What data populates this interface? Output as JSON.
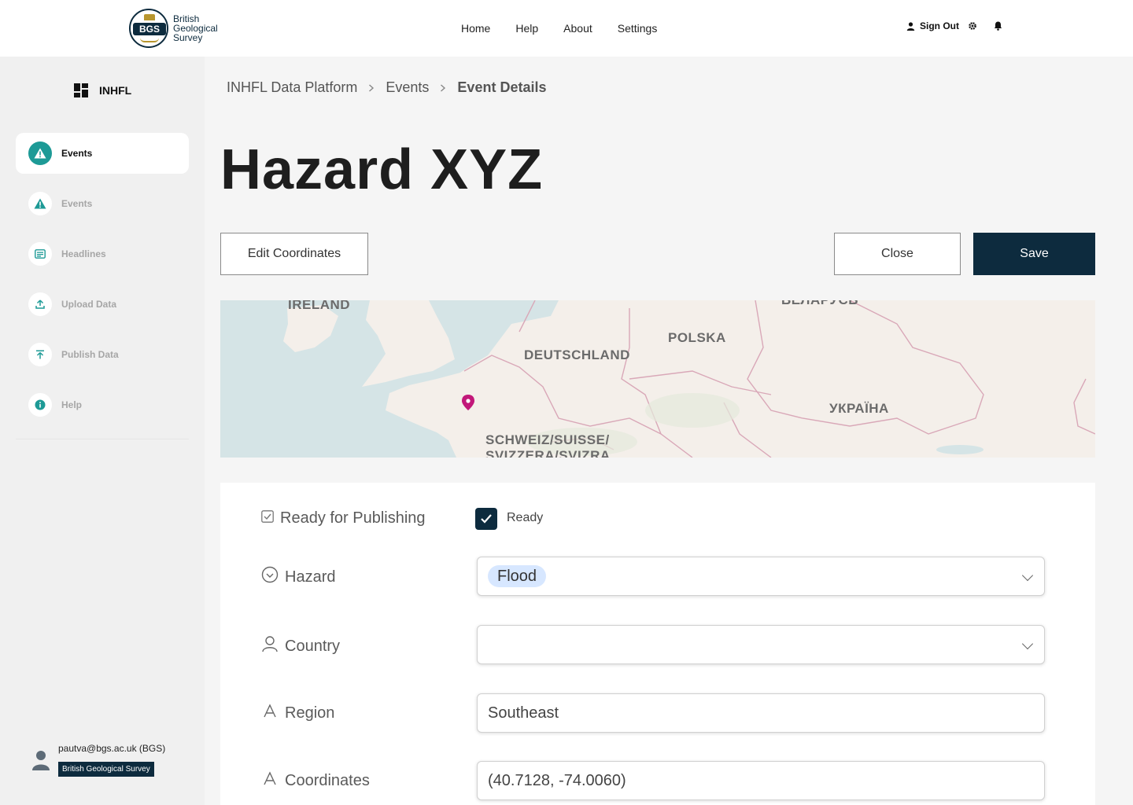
{
  "brand": {
    "logo_letters": "BGS",
    "logo_text": "British Geological Survey"
  },
  "nav": {
    "home": "Home",
    "help": "Help",
    "about": "About",
    "settings": "Settings"
  },
  "user_actions": {
    "sign_out": "Sign Out"
  },
  "sidebar": {
    "title": "INHFL",
    "items": [
      {
        "label": "Events",
        "icon": "warning-icon",
        "active": true
      },
      {
        "label": "Events",
        "icon": "warning-icon",
        "active": false
      },
      {
        "label": "Headlines",
        "icon": "newspaper-icon",
        "active": false
      },
      {
        "label": "Upload Data",
        "icon": "upload-icon",
        "active": false
      },
      {
        "label": "Publish Data",
        "icon": "publish-icon",
        "active": false
      },
      {
        "label": "Help",
        "icon": "info-icon",
        "active": false
      }
    ],
    "user": {
      "email": "pautva@bgs.ac.uk (BGS)",
      "org": "British Geological Survey"
    }
  },
  "breadcrumb": {
    "root": "INHFL Data Platform",
    "section": "Events",
    "current": "Event Details"
  },
  "page": {
    "title": "Hazard XYZ",
    "edit_coordinates": "Edit Coordinates",
    "close": "Close",
    "save": "Save"
  },
  "map": {
    "labels": {
      "ireland": "IRELAND",
      "belarus": "БЕЛАРУСЬ",
      "polska": "POLSKA",
      "deutschland": "DEUTSCHLAND",
      "ukraine": "УКРАЇНА",
      "switzerland_1": "SCHWEIZ/SUISSE/",
      "switzerland_2": "SVIZZERA/SVIZRA"
    },
    "marker_color": "#c2187a"
  },
  "form": {
    "ready": {
      "label": "Ready for Publishing",
      "checkbox_label": "Ready",
      "checked": true
    },
    "hazard": {
      "label": "Hazard",
      "value": "Flood"
    },
    "country": {
      "label": "Country",
      "value": ""
    },
    "region": {
      "label": "Region",
      "value": "Southeast"
    },
    "coordinates": {
      "label": "Coordinates",
      "value": "(40.7128, -74.0060)"
    }
  },
  "colors": {
    "primary": "#0d2b3e",
    "accent": "#1d9a96",
    "chip": "#d7e7ff"
  }
}
